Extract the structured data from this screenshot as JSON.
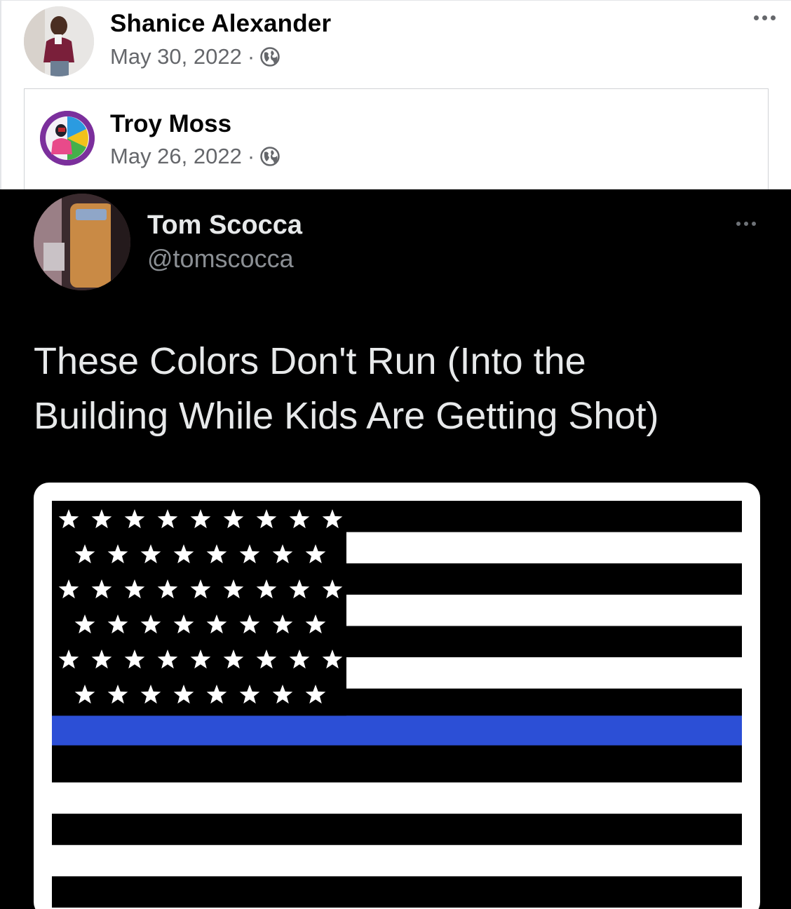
{
  "outer_post": {
    "author": "Shanice Alexander",
    "date": "May 30, 2022",
    "separator": "·",
    "privacy_icon": "globe-icon",
    "more_icon": "more-horizontal-icon"
  },
  "shared_post": {
    "author": "Troy Moss",
    "date": "May 26, 2022",
    "separator": "·",
    "privacy_icon": "globe-icon"
  },
  "tweet": {
    "name": "Tom Scocca",
    "handle": "@tomscocca",
    "text_line1": "These Colors Don't Run (Into the",
    "text_line2": "Building While Kids Are Getting Shot)",
    "more_icon": "more-horizontal-icon"
  },
  "flag": {
    "description_colors": {
      "stripe_dark": "#000000",
      "stripe_light": "#ffffff",
      "thin_line": "#2c4fd6",
      "star": "#ffffff"
    },
    "star_rows": [
      9,
      8,
      9,
      8,
      9,
      8
    ]
  },
  "colors": {
    "name_text": "#050505",
    "meta_text": "#65676b",
    "tweet_bg": "#000000",
    "tweet_text": "#e7e9ea",
    "tweet_handle": "#8b8f94"
  }
}
